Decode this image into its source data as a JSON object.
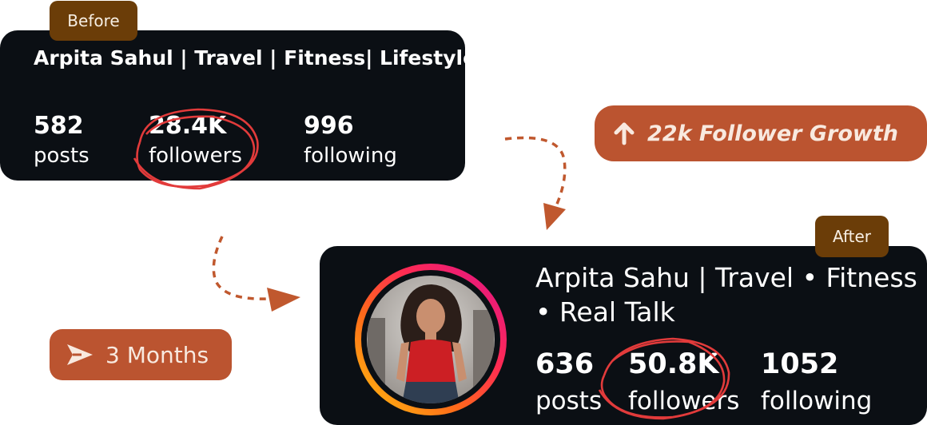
{
  "before": {
    "tag": "Before",
    "name": "Arpita Sahul | Travel | Fitness| Lifestyle",
    "stats": [
      {
        "value": "582",
        "label": "posts"
      },
      {
        "value": "28.4K",
        "label": "followers"
      },
      {
        "value": "996",
        "label": "following"
      }
    ]
  },
  "after": {
    "tag": "After",
    "name_line1": "Arpita Sahu | Travel • Fitness",
    "name_line2": "• Real Talk",
    "stats": [
      {
        "value": "636",
        "label": "posts"
      },
      {
        "value": "50.8K",
        "label": "followers"
      },
      {
        "value": "1052",
        "label": "following"
      }
    ]
  },
  "growth": {
    "label": "22k Follower Growth",
    "icon": "arrow-up-icon"
  },
  "duration": {
    "label": "3 Months",
    "icon": "send-icon"
  },
  "colors": {
    "card_bg": "#0b0f14",
    "tag_bg": "#6b3d08",
    "pill_bg": "#bb5430",
    "accent_red": "#e23b3b",
    "dash": "#c0582e"
  }
}
